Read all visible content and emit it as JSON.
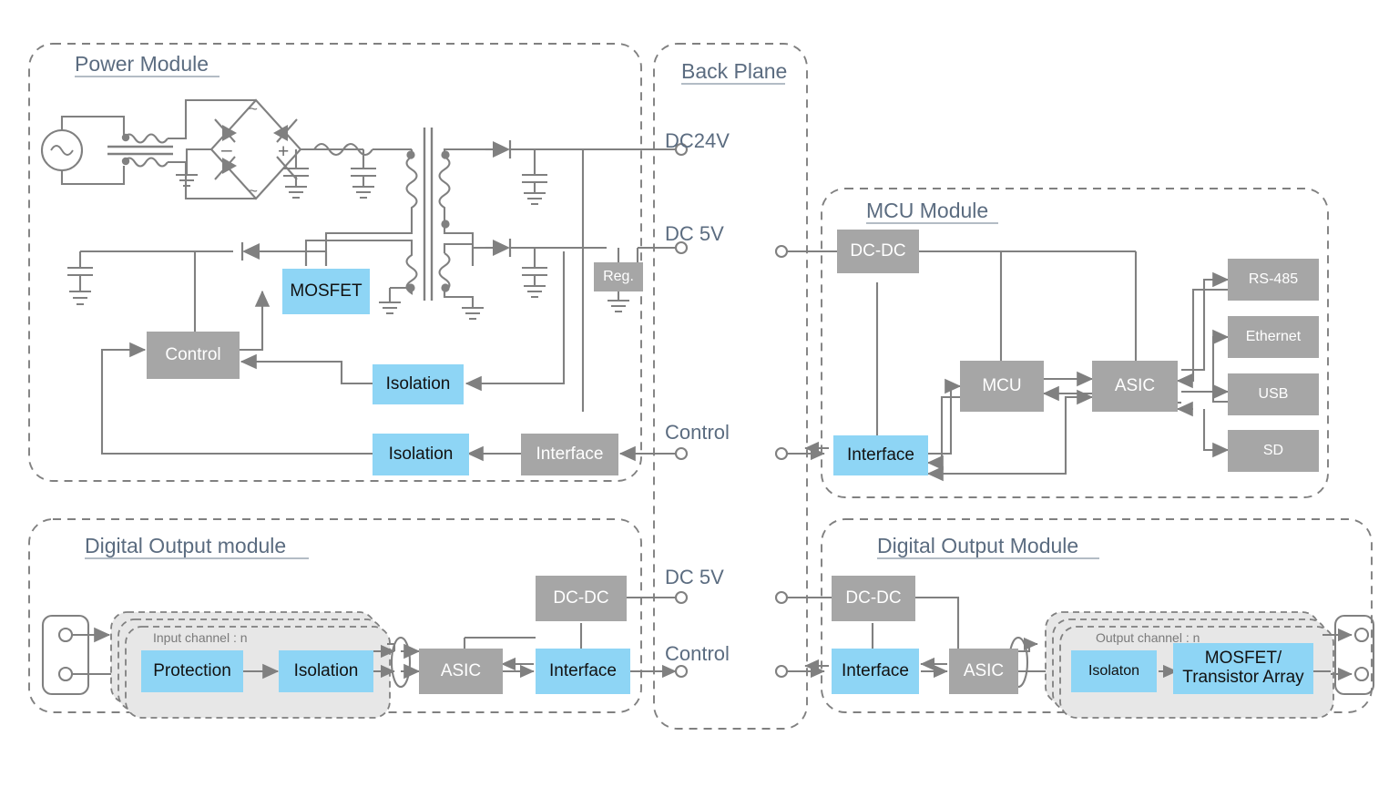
{
  "diagram": {
    "title_color": "#5b6c80",
    "accent_blue": "#8ed5f5",
    "block_gray": "#a6a6a6",
    "line_color": "#808080"
  },
  "modules": {
    "power": {
      "title": "Power Module"
    },
    "backplane": {
      "title": "Back Plane"
    },
    "mcu": {
      "title": "MCU Module"
    },
    "digital_input": {
      "title": "Digital Output module"
    },
    "digital_output": {
      "title": "Digital Output Module"
    }
  },
  "power_module": {
    "blocks": [
      {
        "label": "MOSFET",
        "style": "blue"
      },
      {
        "label": "Control",
        "style": "gray"
      },
      {
        "label": "Isolation",
        "style": "blue"
      },
      {
        "label": "Isolation",
        "style": "blue"
      },
      {
        "label": "Interface",
        "style": "gray"
      },
      {
        "label": "Reg.",
        "style": "gray"
      }
    ],
    "bridge_marks": {
      "ac_top": "~",
      "ac_bottom": "~",
      "minus": "–",
      "plus": "+"
    }
  },
  "backplane": {
    "terminals": [
      {
        "label": "DC24V"
      },
      {
        "label": "DC 5V"
      },
      {
        "label": "Control"
      },
      {
        "label": "DC 5V"
      },
      {
        "label": "Control"
      }
    ]
  },
  "mcu_module": {
    "blocks": [
      {
        "label": "DC-DC",
        "style": "gray"
      },
      {
        "label": "MCU",
        "style": "gray"
      },
      {
        "label": "ASIC",
        "style": "gray"
      },
      {
        "label": "Interface",
        "style": "blue"
      }
    ],
    "peripherals": [
      {
        "label": "RS-485"
      },
      {
        "label": "Ethernet"
      },
      {
        "label": "USB"
      },
      {
        "label": "SD"
      }
    ]
  },
  "digital_input_module": {
    "channel_label": "Input channel : n",
    "blocks": [
      {
        "label": "Protection",
        "style": "blue"
      },
      {
        "label": "Isolation",
        "style": "blue"
      },
      {
        "label": "ASIC",
        "style": "gray"
      },
      {
        "label": "Interface",
        "style": "blue"
      },
      {
        "label": "DC-DC",
        "style": "gray"
      }
    ]
  },
  "digital_output_module": {
    "channel_label": "Output channel : n",
    "blocks": [
      {
        "label": "DC-DC",
        "style": "gray"
      },
      {
        "label": "Interface",
        "style": "blue"
      },
      {
        "label": "ASIC",
        "style": "gray"
      },
      {
        "label": "Isolaton",
        "style": "blue"
      },
      {
        "label": "MOSFET/\nTransistor Array",
        "style": "blue"
      }
    ]
  }
}
